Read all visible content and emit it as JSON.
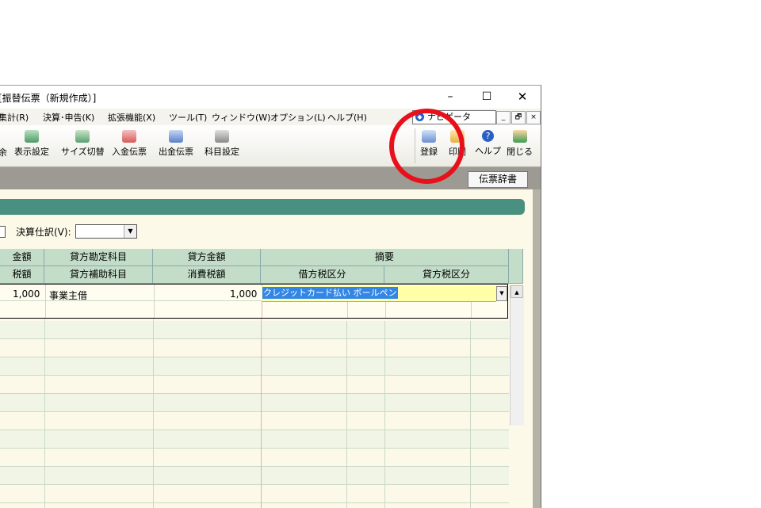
{
  "window": {
    "title": "[振替伝票（新規作成）]",
    "controls": {
      "minimize": "–",
      "maximize": "☐",
      "close": "✕"
    }
  },
  "menu": {
    "items": [
      "集計(R)",
      "決算･申告(K)",
      "拡張機能(X)",
      "ツール(T)",
      "ウィンドウ(W)",
      "オプション(L)",
      "ヘルプ(H)"
    ],
    "navigator": "ナビゲータ",
    "mdi": {
      "minimize": "_",
      "restore": "🗗",
      "close": "×"
    }
  },
  "toolbar": {
    "partial_left": "余",
    "buttons": [
      "表示設定",
      "サイズ切替",
      "入金伝票",
      "出金伝票",
      "科目設定"
    ],
    "right_buttons": [
      "登録",
      "印刷",
      "ヘルプ",
      "閉じる"
    ],
    "colors": {
      "register": "#6a8fd0",
      "print": "#e8b040",
      "help": "#2a5fc4",
      "close": "#3f9a50"
    }
  },
  "dict_button": "伝票辞書",
  "closing": {
    "label": "決算仕訳(V):",
    "value": ""
  },
  "table": {
    "headers_top": [
      "金額",
      "貸方勘定科目",
      "貸方金額",
      "摘要"
    ],
    "headers_bottom": [
      "税額",
      "貸方補助科目",
      "消費税額",
      "借方税区分",
      "貸方税区分"
    ],
    "row1": {
      "debit_amount": "1,000",
      "credit_account": "事業主借",
      "credit_amount": "1,000",
      "summary": "クレジットカード払い ボールペン"
    }
  },
  "colors": {
    "header_bg": "#c3ddc8",
    "green_bar": "#4a9080",
    "highlight": "#3286e6",
    "annotation": "#e8101a"
  }
}
